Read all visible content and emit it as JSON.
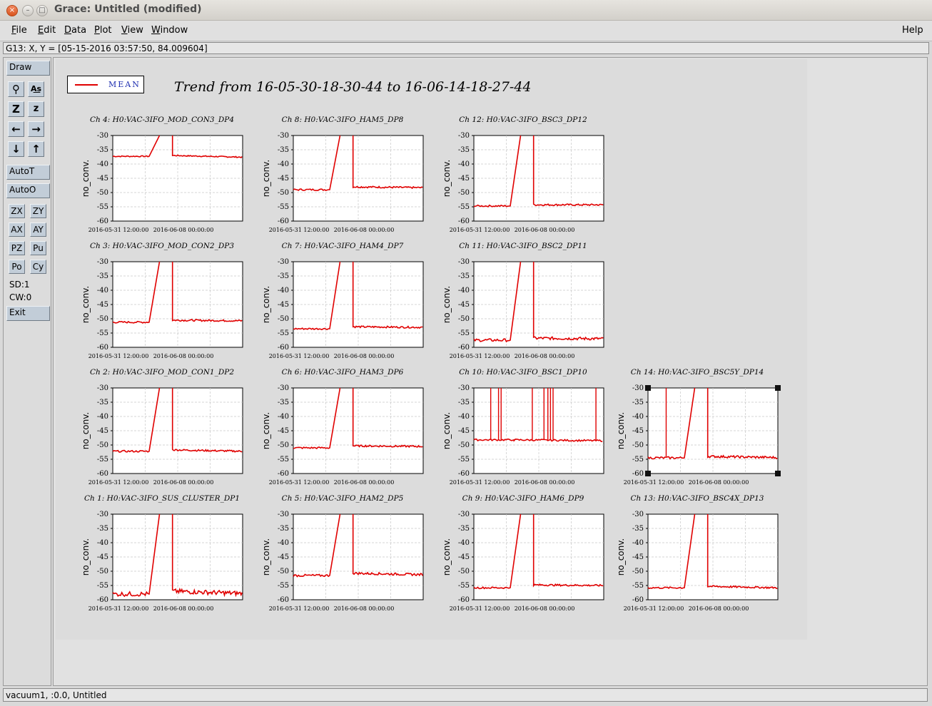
{
  "window": {
    "title": "Grace: Untitled (modified)"
  },
  "menubar": {
    "items": [
      {
        "label": "File",
        "underline": "F",
        "rest": "ile"
      },
      {
        "label": "Edit",
        "underline": "E",
        "rest": "dit"
      },
      {
        "label": "Data",
        "underline": "D",
        "rest": "ata"
      },
      {
        "label": "Plot",
        "underline": "P",
        "rest": "lot"
      },
      {
        "label": "View",
        "underline": "V",
        "rest": "iew"
      },
      {
        "label": "Window",
        "underline": "W",
        "rest": "indow"
      }
    ],
    "help": "Help"
  },
  "locator": "G13: X, Y = [05-15-2016 03:57:50, 84.009604]",
  "toolbar": {
    "draw": "Draw",
    "autot": "AutoT",
    "autoo": "AutoO",
    "small_buttons": [
      "ZX",
      "ZY",
      "AX",
      "AY",
      "PZ",
      "Pu",
      "Po",
      "Cy"
    ],
    "sd": "SD:1",
    "cw": "CW:0",
    "exit": "Exit"
  },
  "status": "vacuum1, :0.0, Untitled",
  "legend": {
    "label": "MEAN",
    "color": "#e00000"
  },
  "title": "Trend from 16-05-30-18-30-44 to 16-06-14-18-27-44",
  "chart_data": [
    {
      "type": "line",
      "title": "Ch 4: H0:VAC-3IFO_MOD_CON3_DP4",
      "ylabel": "no_conv.",
      "ylim": [
        -60,
        -30
      ],
      "yticks": [
        "-30",
        "-35",
        "-40",
        "-45",
        "-50",
        "-55",
        "-60"
      ],
      "xticks": [
        "2016-05-31 12:00:00",
        "2016-06-08 00:00:00"
      ],
      "series": [
        {
          "name": "MEAN",
          "before": -37.3,
          "after": -37.0,
          "end": -37.6,
          "noise": 0.2,
          "spikes": []
        }
      ]
    },
    {
      "type": "line",
      "title": "Ch 8: H0:VAC-3IFO_HAM5_DP8",
      "ylabel": "no_conv.",
      "ylim": [
        -60,
        -30
      ],
      "yticks": [
        "-30",
        "-35",
        "-40",
        "-45",
        "-50",
        "-55",
        "-60"
      ],
      "xticks": [
        "2016-05-31 12:00:00",
        "2016-06-08 00:00:00"
      ],
      "series": [
        {
          "name": "MEAN",
          "before": -49.0,
          "after": -48.0,
          "end": -48.3,
          "noise": 0.3,
          "spikes": []
        }
      ]
    },
    {
      "type": "line",
      "title": "Ch 12: H0:VAC-3IFO_BSC3_DP12",
      "ylabel": "no_conv.",
      "ylim": [
        -60,
        -30
      ],
      "yticks": [
        "-30",
        "-35",
        "-40",
        "-45",
        "-50",
        "-55",
        "-60"
      ],
      "xticks": [
        "2016-05-31 12:00:00",
        "2016-06-08 00:00:00"
      ],
      "series": [
        {
          "name": "MEAN",
          "before": -54.7,
          "after": -54.3,
          "end": -54.3,
          "noise": 0.3,
          "spikes": []
        }
      ]
    },
    {
      "type": "line",
      "title": "Ch 3: H0:VAC-3IFO_MOD_CON2_DP3",
      "ylabel": "no_conv.",
      "ylim": [
        -60,
        -30
      ],
      "yticks": [
        "-30",
        "-35",
        "-40",
        "-45",
        "-50",
        "-55",
        "-60"
      ],
      "xticks": [
        "2016-05-31 12:00:00",
        "2016-06-08 00:00:00"
      ],
      "series": [
        {
          "name": "MEAN",
          "before": -51.2,
          "after": -50.5,
          "end": -50.7,
          "noise": 0.3,
          "spikes": []
        }
      ]
    },
    {
      "type": "line",
      "title": "Ch 7: H0:VAC-3IFO_HAM4_DP7",
      "ylabel": "no_conv.",
      "ylim": [
        -60,
        -30
      ],
      "yticks": [
        "-30",
        "-35",
        "-40",
        "-45",
        "-50",
        "-55",
        "-60"
      ],
      "xticks": [
        "2016-05-31 12:00:00",
        "2016-06-08 00:00:00"
      ],
      "series": [
        {
          "name": "MEAN",
          "before": -53.5,
          "after": -52.8,
          "end": -53.0,
          "noise": 0.3,
          "spikes": []
        }
      ]
    },
    {
      "type": "line",
      "title": "Ch 11: H0:VAC-3IFO_BSC2_DP11",
      "ylabel": "no_conv.",
      "ylim": [
        -60,
        -30
      ],
      "yticks": [
        "-30",
        "-35",
        "-40",
        "-45",
        "-50",
        "-55",
        "-60"
      ],
      "xticks": [
        "2016-05-31 12:00:00",
        "2016-06-08 00:00:00"
      ],
      "series": [
        {
          "name": "MEAN",
          "before": -57.5,
          "after": -56.8,
          "end": -57.0,
          "noise": 0.5,
          "spikes": []
        }
      ]
    },
    {
      "type": "line",
      "title": "Ch 2: H0:VAC-3IFO_MOD_CON1_DP2",
      "ylabel": "no_conv.",
      "ylim": [
        -60,
        -30
      ],
      "yticks": [
        "-30",
        "-35",
        "-40",
        "-45",
        "-50",
        "-55",
        "-60"
      ],
      "xticks": [
        "2016-05-31 12:00:00",
        "2016-06-08 00:00:00"
      ],
      "series": [
        {
          "name": "MEAN",
          "before": -52.2,
          "after": -51.7,
          "end": -52.2,
          "noise": 0.3,
          "spikes": []
        }
      ]
    },
    {
      "type": "line",
      "title": "Ch 6: H0:VAC-3IFO_HAM3_DP6",
      "ylabel": "no_conv.",
      "ylim": [
        -60,
        -30
      ],
      "yticks": [
        "-30",
        "-35",
        "-40",
        "-45",
        "-50",
        "-55",
        "-60"
      ],
      "xticks": [
        "2016-05-31 12:00:00",
        "2016-06-08 00:00:00"
      ],
      "series": [
        {
          "name": "MEAN",
          "before": -51.0,
          "after": -50.3,
          "end": -50.5,
          "noise": 0.3,
          "spikes": []
        }
      ]
    },
    {
      "type": "line",
      "title": "Ch 10: H0:VAC-3IFO_BSC1_DP10",
      "ylabel": "no_conv.",
      "ylim": [
        -60,
        -30
      ],
      "yticks": [
        "-30",
        "-35",
        "-40",
        "-45",
        "-50",
        "-55",
        "-60"
      ],
      "xticks": [
        "2016-05-31 12:00:00",
        "2016-06-08 00:00:00"
      ],
      "series": [
        {
          "name": "MEAN",
          "before": -48.2,
          "after": -48.2,
          "end": -48.5,
          "noise": 0.3,
          "flat": true,
          "spikes": [
            0.13,
            0.19,
            0.21,
            0.45,
            0.54,
            0.57,
            0.59,
            0.61,
            0.94
          ]
        }
      ]
    },
    {
      "type": "line",
      "title": "Ch 14: H0:VAC-3IFO_BSC5Y_DP14",
      "ylabel": "no_conv.",
      "ylim": [
        -60,
        -30
      ],
      "yticks": [
        "-30",
        "-35",
        "-40",
        "-45",
        "-50",
        "-55",
        "-60"
      ],
      "xticks": [
        "2016-05-31 12:00:00",
        "2016-06-08 00:00:00"
      ],
      "series": [
        {
          "name": "MEAN",
          "before": -54.5,
          "after": -54.0,
          "end": -54.4,
          "noise": 0.4,
          "spikes": [
            0.14
          ],
          "selected": true
        }
      ]
    },
    {
      "type": "line",
      "title": "Ch 1: H0:VAC-3IFO_SUS_CLUSTER_DP1",
      "ylabel": "no_conv.",
      "ylim": [
        -60,
        -30
      ],
      "yticks": [
        "-30",
        "-35",
        "-40",
        "-45",
        "-50",
        "-55",
        "-60"
      ],
      "xticks": [
        "2016-05-31 12:00:00",
        "2016-06-08 00:00:00"
      ],
      "series": [
        {
          "name": "MEAN",
          "before": -58.0,
          "after": -57.0,
          "end": -57.8,
          "noise": 0.8,
          "spikes": []
        }
      ]
    },
    {
      "type": "line",
      "title": "Ch 5: H0:VAC-3IFO_HAM2_DP5",
      "ylabel": "no_conv.",
      "ylim": [
        -60,
        -30
      ],
      "yticks": [
        "-30",
        "-35",
        "-40",
        "-45",
        "-50",
        "-55",
        "-60"
      ],
      "xticks": [
        "2016-05-31 12:00:00",
        "2016-06-08 00:00:00"
      ],
      "series": [
        {
          "name": "MEAN",
          "before": -51.5,
          "after": -50.7,
          "end": -51.2,
          "noise": 0.4,
          "spikes": []
        }
      ]
    },
    {
      "type": "line",
      "title": "Ch 9: H0:VAC-3IFO_HAM6_DP9",
      "ylabel": "no_conv.",
      "ylim": [
        -60,
        -30
      ],
      "yticks": [
        "-30",
        "-35",
        "-40",
        "-45",
        "-50",
        "-55",
        "-60"
      ],
      "xticks": [
        "2016-05-31 12:00:00",
        "2016-06-08 00:00:00"
      ],
      "series": [
        {
          "name": "MEAN",
          "before": -55.8,
          "after": -54.8,
          "end": -55.0,
          "noise": 0.3,
          "spikes": []
        }
      ]
    },
    {
      "type": "line",
      "title": "Ch 13: H0:VAC-3IFO_BSC4X_DP13",
      "ylabel": "no_conv.",
      "ylim": [
        -60,
        -30
      ],
      "yticks": [
        "-30",
        "-35",
        "-40",
        "-45",
        "-50",
        "-55",
        "-60"
      ],
      "xticks": [
        "2016-05-31 12:00:00",
        "2016-06-08 00:00:00"
      ],
      "series": [
        {
          "name": "MEAN",
          "before": -55.8,
          "after": -55.3,
          "end": -55.8,
          "noise": 0.3,
          "spikes": []
        }
      ]
    }
  ]
}
